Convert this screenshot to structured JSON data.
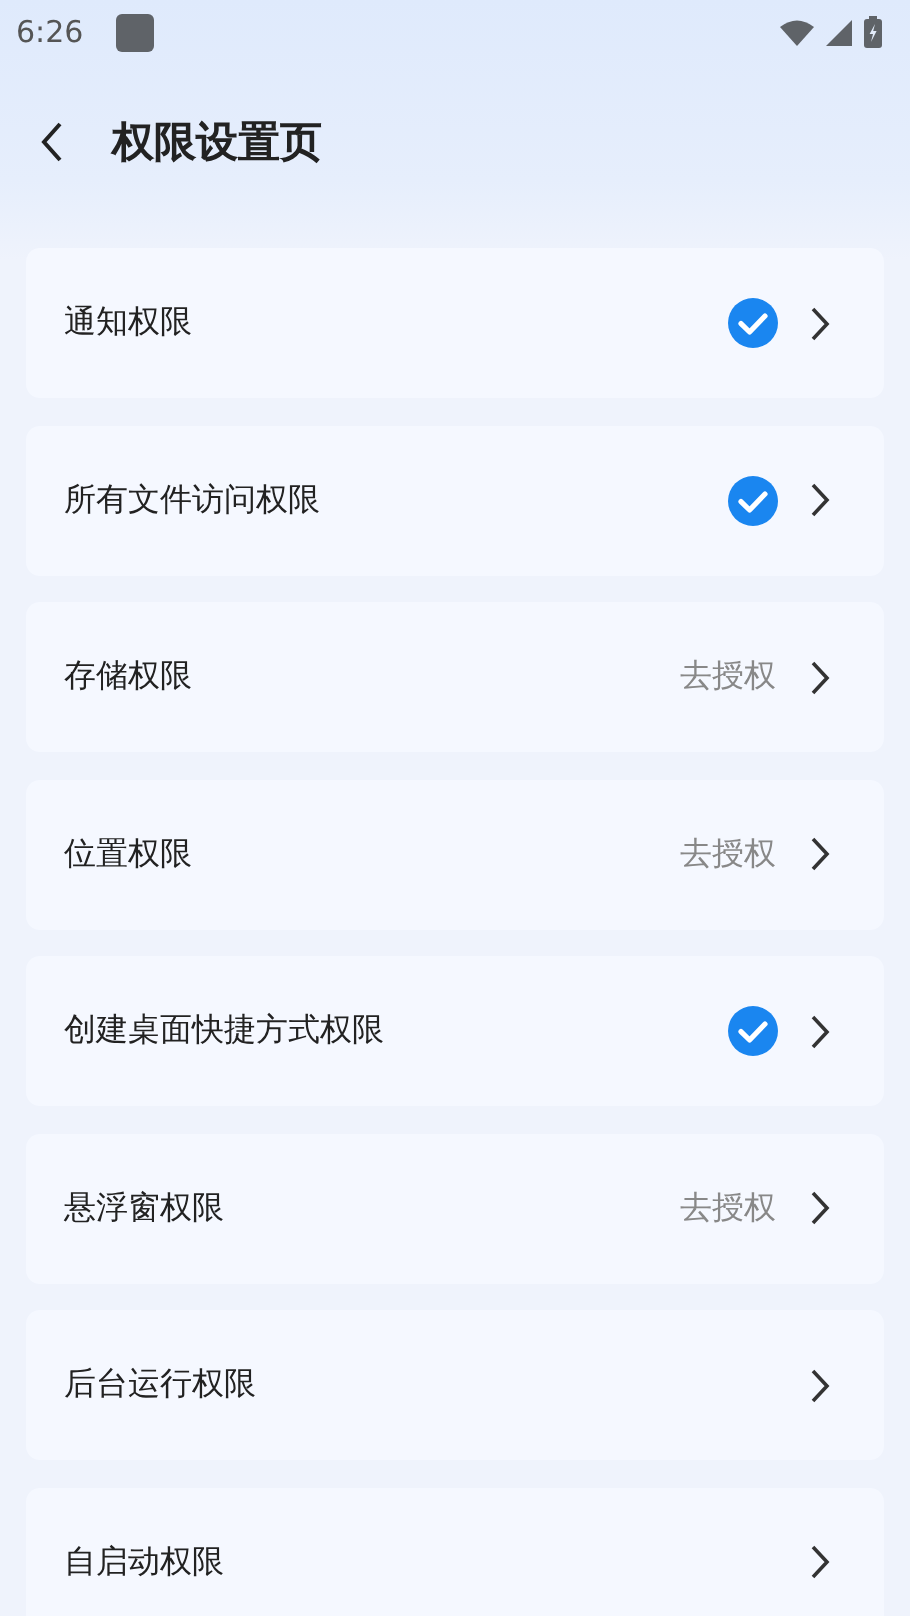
{
  "status_bar": {
    "time": "6:26"
  },
  "header": {
    "title": "权限设置页"
  },
  "permissions": [
    {
      "label": "通知权限",
      "kind": "granted"
    },
    {
      "label": "所有文件访问权限",
      "kind": "granted"
    },
    {
      "label": "存储权限",
      "kind": "action",
      "action": "去授权"
    },
    {
      "label": "位置权限",
      "kind": "action",
      "action": "去授权"
    },
    {
      "label": "创建桌面快捷方式权限",
      "kind": "granted"
    },
    {
      "label": "悬浮窗权限",
      "kind": "action",
      "action": "去授权"
    },
    {
      "label": "后台运行权限",
      "kind": "none"
    },
    {
      "label": "自启动权限",
      "kind": "none"
    }
  ]
}
